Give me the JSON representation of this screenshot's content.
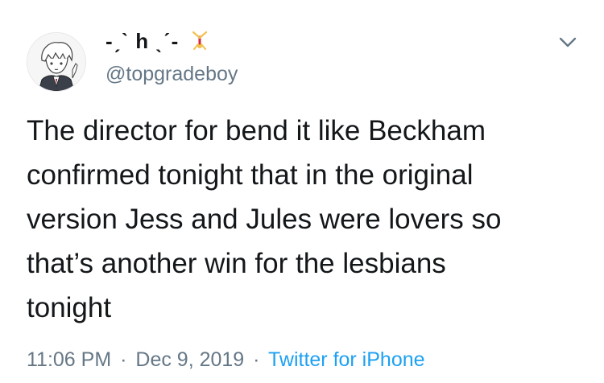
{
  "author": {
    "display_name": "-ˏˋ h ˎˊ-",
    "handle": "@topgradeboy",
    "avatar_icon": "anime-character-avatar",
    "name_emoji_icon": "cartwheel-person-icon"
  },
  "tweet": {
    "text_lines": [
      "The director for bend it like Beckham",
      "confirmed tonight that in the original",
      "version Jess and Jules were lovers so",
      "that’s another win for the lesbians",
      "tonight"
    ]
  },
  "meta": {
    "time": "11:06 PM",
    "separator": "·",
    "date": "Dec 9, 2019",
    "source": "Twitter for iPhone"
  },
  "colors": {
    "text": "#14171a",
    "secondary": "#657786",
    "link": "#1da1f2"
  }
}
